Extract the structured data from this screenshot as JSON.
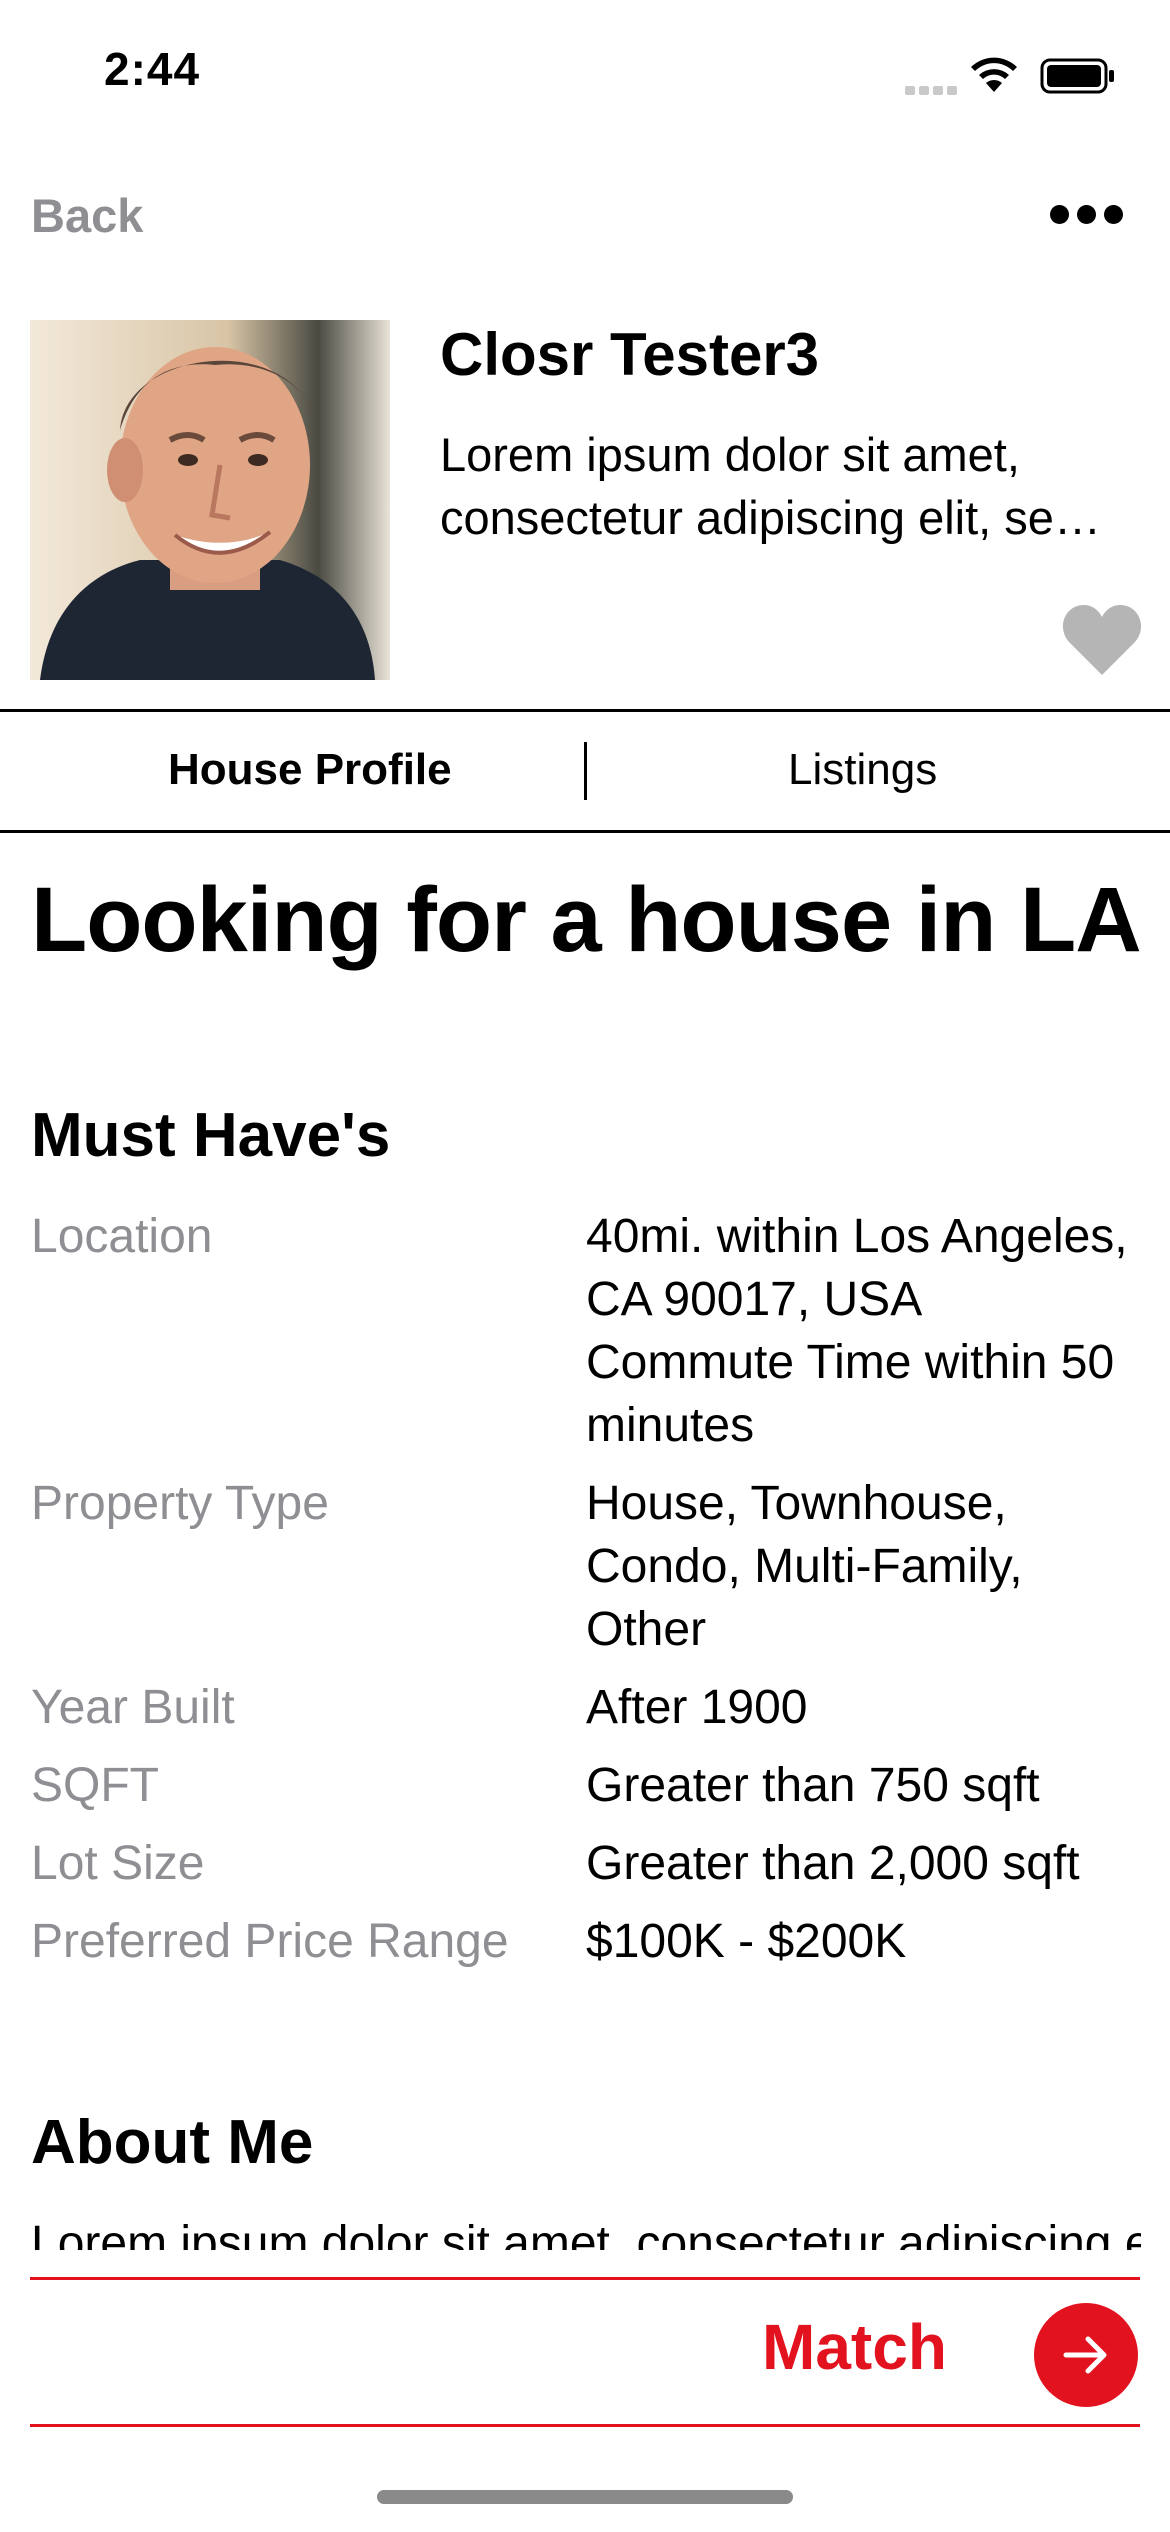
{
  "status_bar": {
    "time": "2:44"
  },
  "nav": {
    "back_label": "Back"
  },
  "profile": {
    "name": "Closr Tester3",
    "bio": "Lorem ipsum dolor sit amet, consectetur adipiscing elit, sed do eiusmod tempor incididunt ut labore"
  },
  "tabs": [
    {
      "label": "House Profile",
      "active": true
    },
    {
      "label": "Listings",
      "active": false
    }
  ],
  "headline": "Looking for a house in LA",
  "must_haves": {
    "title": "Must Have's",
    "rows": [
      {
        "label": "Location",
        "value": "40mi. within Los Angeles, CA 90017, USA Commute Time within 50 minutes"
      },
      {
        "label": "Property Type",
        "value": "House, Townhouse, Condo, Multi-Family, Other"
      },
      {
        "label": "Year Built",
        "value": "After 1900"
      },
      {
        "label": "SQFT",
        "value": "Greater than 750 sqft"
      },
      {
        "label": "Lot Size",
        "value": "Greater than 2,000 sqft"
      },
      {
        "label": "Preferred Price Range",
        "value": "$100K - $200K"
      }
    ]
  },
  "about": {
    "title": "About Me",
    "text": "Lorem ipsum dolor sit amet, consectetur adipiscing elit"
  },
  "action": {
    "match_label": "Match"
  },
  "colors": {
    "accent": "#e2131f",
    "muted": "#8e8e93",
    "heart": "#b5b5b5"
  },
  "icons": [
    "wifi-icon",
    "battery-icon",
    "more-icon",
    "heart-icon",
    "arrow-right-icon"
  ]
}
